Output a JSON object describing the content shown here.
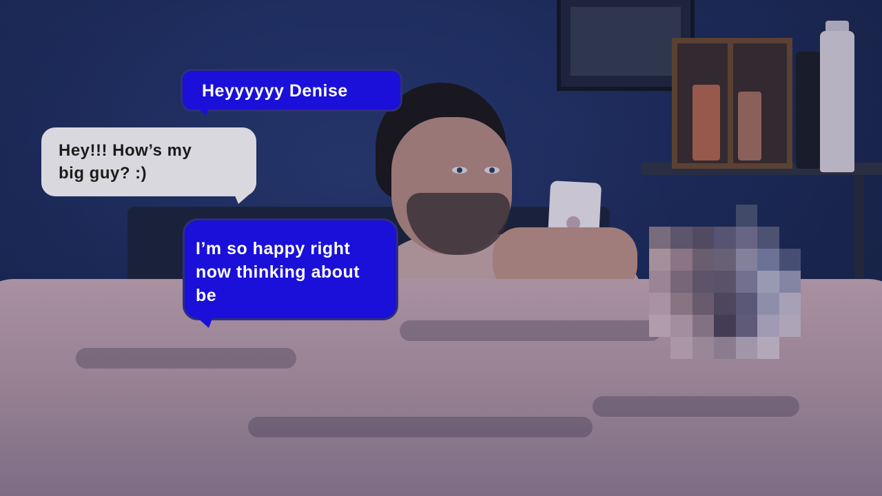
{
  "messages": {
    "outgoing_1": "Heyyyyyy Denise",
    "incoming_1": {
      "lines": [
        "Hey!!! How’s my",
        "big guy? :)"
      ]
    },
    "outgoing_2": {
      "lines": [
        "I’m so happy right",
        "now thinking about",
        "be"
      ]
    }
  },
  "colors": {
    "outgoing_bubble": "#1a10d9",
    "incoming_bubble": "#d9d8de",
    "wall": "#1f2f5f"
  }
}
